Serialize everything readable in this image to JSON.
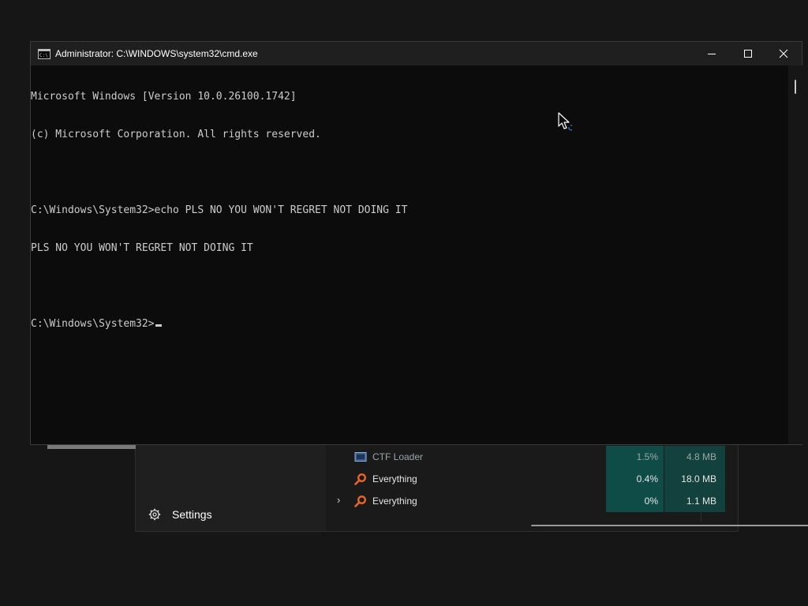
{
  "cmd_window": {
    "title": "Administrator: C:\\WINDOWS\\system32\\cmd.exe",
    "icon": "cmd-app-icon",
    "caption_buttons": [
      "minimize-icon",
      "maximize-icon",
      "close-icon"
    ],
    "console_lines": [
      "Microsoft Windows [Version 10.0.26100.1742]",
      "(c) Microsoft Corporation. All rights reserved.",
      "",
      "C:\\Windows\\System32>echo PLS NO YOU WON'T REGRET NOT DOING IT",
      "PLS NO YOU WON'T REGRET NOT DOING IT",
      "",
      "C:\\Windows\\System32>"
    ],
    "colors": {
      "background": "#0c0c0c",
      "text": "#cccccc",
      "titlebar": "#1f1f1f"
    }
  },
  "task_manager": {
    "nav": {
      "settings_label": "Settings",
      "settings_icon": "gear-icon"
    },
    "processes": [
      {
        "name": "CTF Loader",
        "cpu": "1.5%",
        "memory": "4.8 MB",
        "icon": "ctf-loader-icon",
        "expandable": false
      },
      {
        "name": "Everything",
        "cpu": "0.4%",
        "memory": "18.0 MB",
        "icon": "search-icon",
        "expandable": false
      },
      {
        "name": "Everything",
        "cpu": "0%",
        "memory": "1.1 MB",
        "icon": "search-icon",
        "expandable": true
      }
    ],
    "colors": {
      "cpu_heat": "#0f4c48",
      "memory_heat": "#12413e",
      "search_icon": "#e8652b"
    }
  }
}
